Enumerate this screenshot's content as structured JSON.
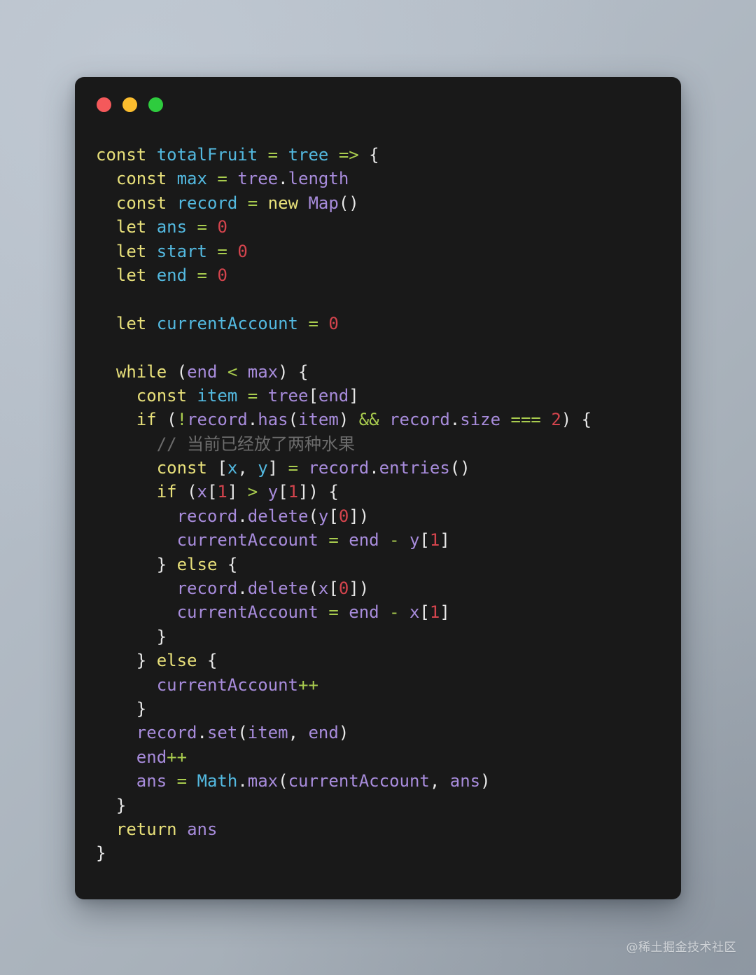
{
  "window": {
    "background_color": "#191919",
    "traffic_lights": [
      {
        "name": "close",
        "color": "#f4595b"
      },
      {
        "name": "minimize",
        "color": "#fbbd2e"
      },
      {
        "name": "maximize",
        "color": "#2ecc3e"
      }
    ]
  },
  "theme": {
    "keyword": "#e8e07a",
    "declaration": "#53b9e0",
    "operator": "#a9cc4e",
    "property": "#a88cdc",
    "variable": "#a88cdc",
    "number": "#d4444d",
    "punctuation": "#e8e8e8",
    "comment": "#6c6c6c",
    "page_background": "#b3bcc6"
  },
  "watermark": {
    "text": "@稀土掘金技术社区"
  },
  "code": {
    "language": "javascript",
    "plain_text": "const totalFruit = tree => {\n  const max = tree.length\n  const record = new Map()\n  let ans = 0\n  let start = 0\n  let end = 0\n\n  let currentAccount = 0\n\n  while (end < max) {\n    const item = tree[end]\n    if (!record.has(item) && record.size === 2) {\n      // 当前已经放了两种水果\n      const [x, y] = record.entries()\n      if (x[1] > y[1]) {\n        record.delete(y[0])\n        currentAccount = end - y[1]\n      } else {\n        record.delete(x[0])\n        currentAccount = end - x[1]\n      }\n    } else {\n      currentAccount++\n    }\n    record.set(item, end)\n    end++\n    ans = Math.max(currentAccount, ans)\n  }\n  return ans\n}",
    "lines": [
      [
        {
          "t": "const",
          "c": "kw"
        },
        {
          "t": " ",
          "c": "plain"
        },
        {
          "t": "totalFruit",
          "c": "decl"
        },
        {
          "t": " ",
          "c": "plain"
        },
        {
          "t": "=",
          "c": "op"
        },
        {
          "t": " ",
          "c": "plain"
        },
        {
          "t": "tree",
          "c": "decl"
        },
        {
          "t": " ",
          "c": "plain"
        },
        {
          "t": "=>",
          "c": "op"
        },
        {
          "t": " ",
          "c": "plain"
        },
        {
          "t": "{",
          "c": "punct"
        }
      ],
      [
        {
          "t": "  ",
          "c": "plain"
        },
        {
          "t": "const",
          "c": "kw"
        },
        {
          "t": " ",
          "c": "plain"
        },
        {
          "t": "max",
          "c": "decl"
        },
        {
          "t": " ",
          "c": "plain"
        },
        {
          "t": "=",
          "c": "op"
        },
        {
          "t": " ",
          "c": "plain"
        },
        {
          "t": "tree",
          "c": "var"
        },
        {
          "t": ".",
          "c": "punct"
        },
        {
          "t": "length",
          "c": "prop"
        }
      ],
      [
        {
          "t": "  ",
          "c": "plain"
        },
        {
          "t": "const",
          "c": "kw"
        },
        {
          "t": " ",
          "c": "plain"
        },
        {
          "t": "record",
          "c": "decl"
        },
        {
          "t": " ",
          "c": "plain"
        },
        {
          "t": "=",
          "c": "op"
        },
        {
          "t": " ",
          "c": "plain"
        },
        {
          "t": "new",
          "c": "kw"
        },
        {
          "t": " ",
          "c": "plain"
        },
        {
          "t": "Map",
          "c": "prop"
        },
        {
          "t": "()",
          "c": "punct"
        }
      ],
      [
        {
          "t": "  ",
          "c": "plain"
        },
        {
          "t": "let",
          "c": "kw"
        },
        {
          "t": " ",
          "c": "plain"
        },
        {
          "t": "ans",
          "c": "decl"
        },
        {
          "t": " ",
          "c": "plain"
        },
        {
          "t": "=",
          "c": "op"
        },
        {
          "t": " ",
          "c": "plain"
        },
        {
          "t": "0",
          "c": "num"
        }
      ],
      [
        {
          "t": "  ",
          "c": "plain"
        },
        {
          "t": "let",
          "c": "kw"
        },
        {
          "t": " ",
          "c": "plain"
        },
        {
          "t": "start",
          "c": "decl"
        },
        {
          "t": " ",
          "c": "plain"
        },
        {
          "t": "=",
          "c": "op"
        },
        {
          "t": " ",
          "c": "plain"
        },
        {
          "t": "0",
          "c": "num"
        }
      ],
      [
        {
          "t": "  ",
          "c": "plain"
        },
        {
          "t": "let",
          "c": "kw"
        },
        {
          "t": " ",
          "c": "plain"
        },
        {
          "t": "end",
          "c": "decl"
        },
        {
          "t": " ",
          "c": "plain"
        },
        {
          "t": "=",
          "c": "op"
        },
        {
          "t": " ",
          "c": "plain"
        },
        {
          "t": "0",
          "c": "num"
        }
      ],
      [],
      [
        {
          "t": "  ",
          "c": "plain"
        },
        {
          "t": "let",
          "c": "kw"
        },
        {
          "t": " ",
          "c": "plain"
        },
        {
          "t": "currentAccount",
          "c": "decl"
        },
        {
          "t": " ",
          "c": "plain"
        },
        {
          "t": "=",
          "c": "op"
        },
        {
          "t": " ",
          "c": "plain"
        },
        {
          "t": "0",
          "c": "num"
        }
      ],
      [],
      [
        {
          "t": "  ",
          "c": "plain"
        },
        {
          "t": "while",
          "c": "kw"
        },
        {
          "t": " ",
          "c": "plain"
        },
        {
          "t": "(",
          "c": "punct"
        },
        {
          "t": "end",
          "c": "var"
        },
        {
          "t": " ",
          "c": "plain"
        },
        {
          "t": "<",
          "c": "op"
        },
        {
          "t": " ",
          "c": "plain"
        },
        {
          "t": "max",
          "c": "var"
        },
        {
          "t": ") ",
          "c": "punct"
        },
        {
          "t": "{",
          "c": "punct"
        }
      ],
      [
        {
          "t": "    ",
          "c": "plain"
        },
        {
          "t": "const",
          "c": "kw"
        },
        {
          "t": " ",
          "c": "plain"
        },
        {
          "t": "item",
          "c": "decl"
        },
        {
          "t": " ",
          "c": "plain"
        },
        {
          "t": "=",
          "c": "op"
        },
        {
          "t": " ",
          "c": "plain"
        },
        {
          "t": "tree",
          "c": "var"
        },
        {
          "t": "[",
          "c": "punct"
        },
        {
          "t": "end",
          "c": "var"
        },
        {
          "t": "]",
          "c": "punct"
        }
      ],
      [
        {
          "t": "    ",
          "c": "plain"
        },
        {
          "t": "if",
          "c": "kw"
        },
        {
          "t": " ",
          "c": "plain"
        },
        {
          "t": "(",
          "c": "punct"
        },
        {
          "t": "!",
          "c": "op"
        },
        {
          "t": "record",
          "c": "var"
        },
        {
          "t": ".",
          "c": "punct"
        },
        {
          "t": "has",
          "c": "prop"
        },
        {
          "t": "(",
          "c": "punct"
        },
        {
          "t": "item",
          "c": "var"
        },
        {
          "t": ")",
          "c": "punct"
        },
        {
          "t": " ",
          "c": "plain"
        },
        {
          "t": "&&",
          "c": "op"
        },
        {
          "t": " ",
          "c": "plain"
        },
        {
          "t": "record",
          "c": "var"
        },
        {
          "t": ".",
          "c": "punct"
        },
        {
          "t": "size",
          "c": "prop"
        },
        {
          "t": " ",
          "c": "plain"
        },
        {
          "t": "===",
          "c": "op"
        },
        {
          "t": " ",
          "c": "plain"
        },
        {
          "t": "2",
          "c": "num"
        },
        {
          "t": ") ",
          "c": "punct"
        },
        {
          "t": "{",
          "c": "punct"
        }
      ],
      [
        {
          "t": "      ",
          "c": "plain"
        },
        {
          "t": "// 当前已经放了两种水果",
          "c": "comment"
        }
      ],
      [
        {
          "t": "      ",
          "c": "plain"
        },
        {
          "t": "const",
          "c": "kw"
        },
        {
          "t": " ",
          "c": "plain"
        },
        {
          "t": "[",
          "c": "punct"
        },
        {
          "t": "x",
          "c": "decl"
        },
        {
          "t": ", ",
          "c": "punct"
        },
        {
          "t": "y",
          "c": "decl"
        },
        {
          "t": "]",
          "c": "punct"
        },
        {
          "t": " ",
          "c": "plain"
        },
        {
          "t": "=",
          "c": "op"
        },
        {
          "t": " ",
          "c": "plain"
        },
        {
          "t": "record",
          "c": "var"
        },
        {
          "t": ".",
          "c": "punct"
        },
        {
          "t": "entries",
          "c": "prop"
        },
        {
          "t": "()",
          "c": "punct"
        }
      ],
      [
        {
          "t": "      ",
          "c": "plain"
        },
        {
          "t": "if",
          "c": "kw"
        },
        {
          "t": " ",
          "c": "plain"
        },
        {
          "t": "(",
          "c": "punct"
        },
        {
          "t": "x",
          "c": "var"
        },
        {
          "t": "[",
          "c": "punct"
        },
        {
          "t": "1",
          "c": "num"
        },
        {
          "t": "]",
          "c": "punct"
        },
        {
          "t": " ",
          "c": "plain"
        },
        {
          "t": ">",
          "c": "op"
        },
        {
          "t": " ",
          "c": "plain"
        },
        {
          "t": "y",
          "c": "var"
        },
        {
          "t": "[",
          "c": "punct"
        },
        {
          "t": "1",
          "c": "num"
        },
        {
          "t": "]",
          "c": "punct"
        },
        {
          "t": ") ",
          "c": "punct"
        },
        {
          "t": "{",
          "c": "punct"
        }
      ],
      [
        {
          "t": "        ",
          "c": "plain"
        },
        {
          "t": "record",
          "c": "var"
        },
        {
          "t": ".",
          "c": "punct"
        },
        {
          "t": "delete",
          "c": "prop"
        },
        {
          "t": "(",
          "c": "punct"
        },
        {
          "t": "y",
          "c": "var"
        },
        {
          "t": "[",
          "c": "punct"
        },
        {
          "t": "0",
          "c": "num"
        },
        {
          "t": "])",
          "c": "punct"
        }
      ],
      [
        {
          "t": "        ",
          "c": "plain"
        },
        {
          "t": "currentAccount",
          "c": "var"
        },
        {
          "t": " ",
          "c": "plain"
        },
        {
          "t": "=",
          "c": "op"
        },
        {
          "t": " ",
          "c": "plain"
        },
        {
          "t": "end",
          "c": "var"
        },
        {
          "t": " ",
          "c": "plain"
        },
        {
          "t": "-",
          "c": "op"
        },
        {
          "t": " ",
          "c": "plain"
        },
        {
          "t": "y",
          "c": "var"
        },
        {
          "t": "[",
          "c": "punct"
        },
        {
          "t": "1",
          "c": "num"
        },
        {
          "t": "]",
          "c": "punct"
        }
      ],
      [
        {
          "t": "      ",
          "c": "plain"
        },
        {
          "t": "} ",
          "c": "punct"
        },
        {
          "t": "else",
          "c": "kw"
        },
        {
          "t": " ",
          "c": "plain"
        },
        {
          "t": "{",
          "c": "punct"
        }
      ],
      [
        {
          "t": "        ",
          "c": "plain"
        },
        {
          "t": "record",
          "c": "var"
        },
        {
          "t": ".",
          "c": "punct"
        },
        {
          "t": "delete",
          "c": "prop"
        },
        {
          "t": "(",
          "c": "punct"
        },
        {
          "t": "x",
          "c": "var"
        },
        {
          "t": "[",
          "c": "punct"
        },
        {
          "t": "0",
          "c": "num"
        },
        {
          "t": "])",
          "c": "punct"
        }
      ],
      [
        {
          "t": "        ",
          "c": "plain"
        },
        {
          "t": "currentAccount",
          "c": "var"
        },
        {
          "t": " ",
          "c": "plain"
        },
        {
          "t": "=",
          "c": "op"
        },
        {
          "t": " ",
          "c": "plain"
        },
        {
          "t": "end",
          "c": "var"
        },
        {
          "t": " ",
          "c": "plain"
        },
        {
          "t": "-",
          "c": "op"
        },
        {
          "t": " ",
          "c": "plain"
        },
        {
          "t": "x",
          "c": "var"
        },
        {
          "t": "[",
          "c": "punct"
        },
        {
          "t": "1",
          "c": "num"
        },
        {
          "t": "]",
          "c": "punct"
        }
      ],
      [
        {
          "t": "      ",
          "c": "plain"
        },
        {
          "t": "}",
          "c": "punct"
        }
      ],
      [
        {
          "t": "    ",
          "c": "plain"
        },
        {
          "t": "} ",
          "c": "punct"
        },
        {
          "t": "else",
          "c": "kw"
        },
        {
          "t": " ",
          "c": "plain"
        },
        {
          "t": "{",
          "c": "punct"
        }
      ],
      [
        {
          "t": "      ",
          "c": "plain"
        },
        {
          "t": "currentAccount",
          "c": "var"
        },
        {
          "t": "++",
          "c": "op"
        }
      ],
      [
        {
          "t": "    ",
          "c": "plain"
        },
        {
          "t": "}",
          "c": "punct"
        }
      ],
      [
        {
          "t": "    ",
          "c": "plain"
        },
        {
          "t": "record",
          "c": "var"
        },
        {
          "t": ".",
          "c": "punct"
        },
        {
          "t": "set",
          "c": "prop"
        },
        {
          "t": "(",
          "c": "punct"
        },
        {
          "t": "item",
          "c": "var"
        },
        {
          "t": ", ",
          "c": "punct"
        },
        {
          "t": "end",
          "c": "var"
        },
        {
          "t": ")",
          "c": "punct"
        }
      ],
      [
        {
          "t": "    ",
          "c": "plain"
        },
        {
          "t": "end",
          "c": "var"
        },
        {
          "t": "++",
          "c": "op"
        }
      ],
      [
        {
          "t": "    ",
          "c": "plain"
        },
        {
          "t": "ans",
          "c": "var"
        },
        {
          "t": " ",
          "c": "plain"
        },
        {
          "t": "=",
          "c": "op"
        },
        {
          "t": " ",
          "c": "plain"
        },
        {
          "t": "Math",
          "c": "decl"
        },
        {
          "t": ".",
          "c": "punct"
        },
        {
          "t": "max",
          "c": "prop"
        },
        {
          "t": "(",
          "c": "punct"
        },
        {
          "t": "currentAccount",
          "c": "var"
        },
        {
          "t": ", ",
          "c": "punct"
        },
        {
          "t": "ans",
          "c": "var"
        },
        {
          "t": ")",
          "c": "punct"
        }
      ],
      [
        {
          "t": "  ",
          "c": "plain"
        },
        {
          "t": "}",
          "c": "punct"
        }
      ],
      [
        {
          "t": "  ",
          "c": "plain"
        },
        {
          "t": "return",
          "c": "kw"
        },
        {
          "t": " ",
          "c": "plain"
        },
        {
          "t": "ans",
          "c": "var"
        }
      ],
      [
        {
          "t": "}",
          "c": "punct"
        }
      ]
    ]
  }
}
